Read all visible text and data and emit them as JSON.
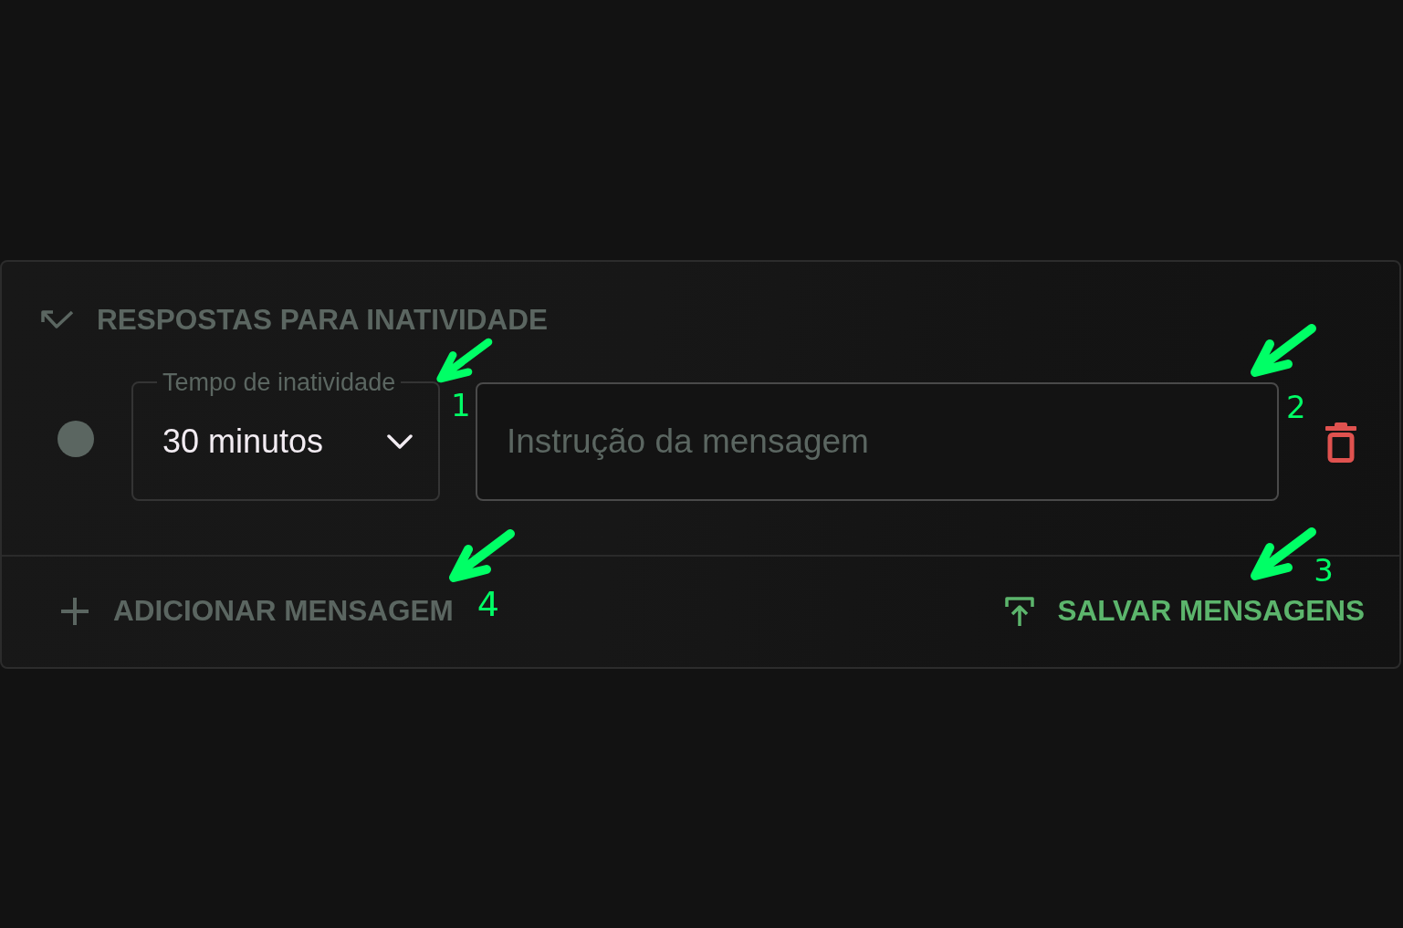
{
  "section": {
    "title": "RESPOSTAS PARA INATIVIDADE",
    "messages": [
      {
        "color": "#5b6661",
        "delay": {
          "label": "Tempo de inatividade",
          "value": "30 minutos",
          "annotation": "1"
        },
        "instruction": {
          "placeholder": "Instrução da mensagem",
          "annotation": "2"
        }
      }
    ],
    "actions": [
      {
        "kind": "add",
        "label": "ADICIONAR MENSAGEM",
        "annotation": "4"
      },
      {
        "kind": "save",
        "label": "SALVAR MENSAGENS",
        "annotation": "3"
      }
    ]
  }
}
